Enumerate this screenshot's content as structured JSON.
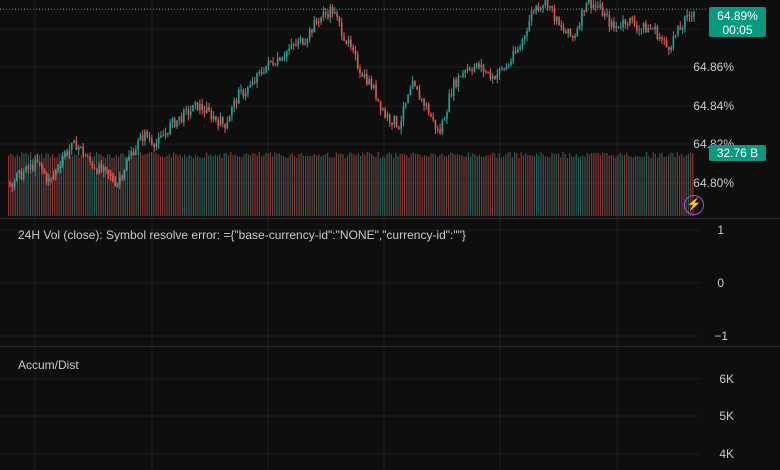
{
  "colors": {
    "up": "#26a69a",
    "down": "#ef5350",
    "tag_bg": "#089981",
    "background": "#0e0e0e",
    "grid": "#1f1f22"
  },
  "price_axis": {
    "ticks": [
      "64.86%",
      "64.84%",
      "64.82%",
      "64.80%"
    ],
    "current_price": "64.89%",
    "countdown": "00:05",
    "volume_tag": "32.76 B"
  },
  "volume_pane": {
    "title": "24H Vol (close): Symbol resolve error: ={\"base-currency-id\":\"NONE\",\"currency-id\":\"\"}",
    "ticks": [
      "1",
      "0",
      "−1"
    ]
  },
  "ad_pane": {
    "title": "Accum/Dist",
    "ticks": [
      "6K",
      "5K",
      "4K"
    ]
  },
  "icons": {
    "replay": "lightning-icon"
  },
  "chart_data": {
    "type": "candlestick",
    "y_unit": "%",
    "ylim": [
      64.79,
      64.895
    ],
    "last_value": 64.89,
    "approx_close_path": [
      64.8,
      64.805,
      64.81,
      64.8,
      64.815,
      64.82,
      64.81,
      64.805,
      64.8,
      64.815,
      64.825,
      64.82,
      64.83,
      64.835,
      64.84,
      64.835,
      64.83,
      64.845,
      64.85,
      64.86,
      64.865,
      64.87,
      64.875,
      64.885,
      64.89,
      64.875,
      64.86,
      64.85,
      64.835,
      64.83,
      64.85,
      64.84,
      64.825,
      64.85,
      64.86,
      64.86,
      64.855,
      64.86,
      64.87,
      64.89,
      64.895,
      64.88,
      64.875,
      64.895,
      64.89,
      64.88,
      64.885,
      64.88,
      64.88,
      64.87,
      64.88,
      64.89
    ],
    "volume_tag_value": "32.76 B"
  }
}
